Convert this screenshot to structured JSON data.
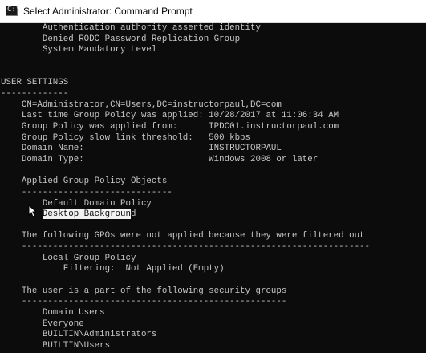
{
  "window": {
    "title": "Select Administrator: Command Prompt",
    "icon": "command-prompt-icon"
  },
  "console": {
    "prefix_lines": [
      "        Authentication authority asserted identity",
      "        Denied RODC Password Replication Group",
      "        System Mandatory Level",
      "",
      "",
      "USER SETTINGS",
      "-------------",
      "    CN=Administrator,CN=Users,DC=instructorpaul,DC=com",
      "    Last time Group Policy was applied: 10/28/2017 at 11:06:34 AM",
      "    Group Policy was applied from:      IPDC01.instructorpaul.com",
      "    Group Policy slow link threshold:   500 kbps",
      "    Domain Name:                        INSTRUCTORPAUL",
      "    Domain Type:                        Windows 2008 or later",
      "",
      "    Applied Group Policy Objects",
      "    -----------------------------",
      "        Default Domain Policy"
    ],
    "selected_line_indent": "        ",
    "selected_text": "Desktop Backgroun",
    "selected_line_rest": "d",
    "suffix_lines": [
      "",
      "    The following GPOs were not applied because they were filtered out",
      "    -------------------------------------------------------------------",
      "        Local Group Policy",
      "            Filtering:  Not Applied (Empty)",
      "",
      "    The user is a part of the following security groups",
      "    ---------------------------------------------------",
      "        Domain Users",
      "        Everyone",
      "        BUILTIN\\Administrators",
      "        BUILTIN\\Users"
    ]
  },
  "colors": {
    "console_bg": "#0c0c0c",
    "console_text": "#c7c7c7",
    "selection_bg": "#f2f2f2",
    "titlebar_bg": "#ffffff"
  }
}
